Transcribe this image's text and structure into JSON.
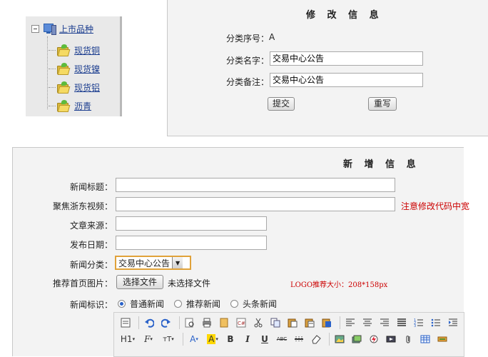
{
  "tree": {
    "root_label": "上市品种",
    "items": [
      "现货铜",
      "现货镍",
      "现货铝",
      "沥青"
    ]
  },
  "modify": {
    "title": "修 改 信 息",
    "seq_label": "分类序号：",
    "seq_value": "A",
    "name_label": "分类名字：",
    "name_value": "交易中心公告",
    "note_label": "分类备注：",
    "note_value": "交易中心公告",
    "submit": "提交",
    "reset": "重写"
  },
  "add": {
    "title": "新 增 信 息",
    "news_title_label": "新闻标题：",
    "video_label": "聚焦浙东视频：",
    "video_hint": "注意修改代码中宽",
    "source_label": "文章来源：",
    "date_label": "发布日期：",
    "category_label": "新闻分类：",
    "category_value": "交易中心公告",
    "image_label": "推荐首页图片：",
    "file_button": "选择文件",
    "file_status": "未选择文件",
    "logo_hint": "LOGO推荐大小：208*158px",
    "flag_label": "新闻标识：",
    "flags": [
      "普通新闻",
      "推荐新闻",
      "头条新闻"
    ],
    "flag_selected": 0
  },
  "colors": {
    "hint_red": "#cc0000",
    "link_blue": "#1b3d8f",
    "select_border": "#e0a23a"
  },
  "toolbar": {
    "row1_icons": [
      "source-icon",
      "undo-icon",
      "redo-icon",
      "preview-icon",
      "print-icon",
      "template-icon",
      "code-icon",
      "cut-icon",
      "copy-icon",
      "paste-icon",
      "paste-text-icon",
      "paste-word-icon",
      "align-left-icon",
      "align-center-icon",
      "align-right-icon",
      "justify-icon",
      "ordered-list-icon",
      "unordered-list-icon",
      "indent-icon"
    ],
    "row2": {
      "heading": "H1",
      "font": "F",
      "size": "тT",
      "font_color": "A",
      "highlight": "A",
      "bold": "B",
      "italic": "I",
      "underline": "U",
      "strike": "ABC",
      "hr_icon": "horizontal-rule-icon",
      "eraser_icon": "eraser-icon",
      "image_icon": "image-icon",
      "multi_image_icon": "multi-image-icon",
      "flash_icon": "flash-icon",
      "media_icon": "media-icon",
      "attach_icon": "attachment-icon",
      "table_icon": "table-icon",
      "link_icon": "link-icon"
    }
  }
}
